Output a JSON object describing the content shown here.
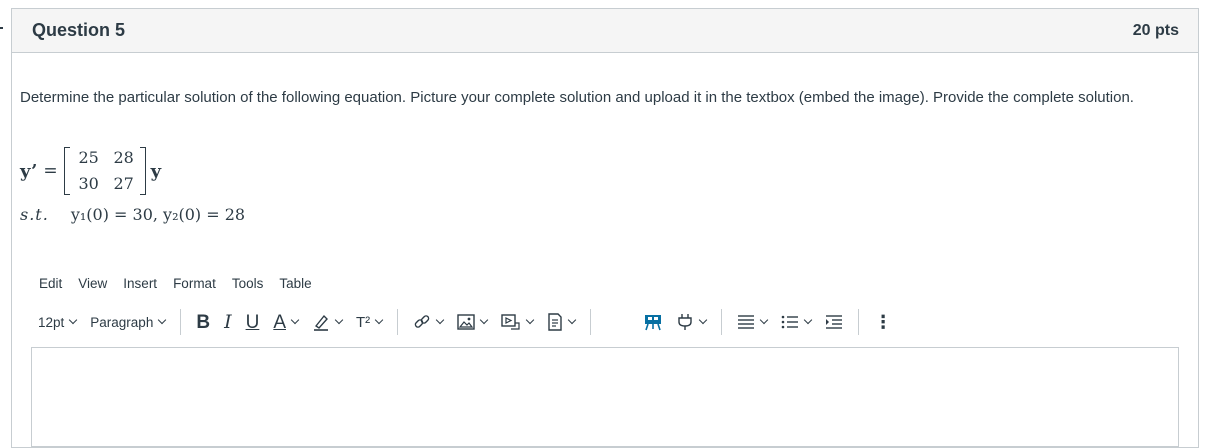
{
  "question": {
    "title": "Question 5",
    "points": "20 pts",
    "prompt": "Determine the particular solution of the following equation. Picture your complete solution and upload it in the textbox (embed the image). Provide the complete solution."
  },
  "equation": {
    "lhs": "y’",
    "equals": "=",
    "matrix": [
      "25",
      "28",
      "30",
      "27"
    ],
    "rhs": "y",
    "st_label": "s.t.",
    "conditions": "y₁(0) = 30, y₂(0) = 28"
  },
  "editor": {
    "menu": [
      "Edit",
      "View",
      "Insert",
      "Format",
      "Tools",
      "Table"
    ],
    "font_size": "12pt",
    "block_format": "Paragraph",
    "bold": "B",
    "italic": "I",
    "underline": "U",
    "text_color": "A",
    "superscript": "T²",
    "more": "⋮"
  },
  "colors": {
    "accent": "#0770a3",
    "border": "#c7cdd1",
    "text": "#2d3b45"
  }
}
